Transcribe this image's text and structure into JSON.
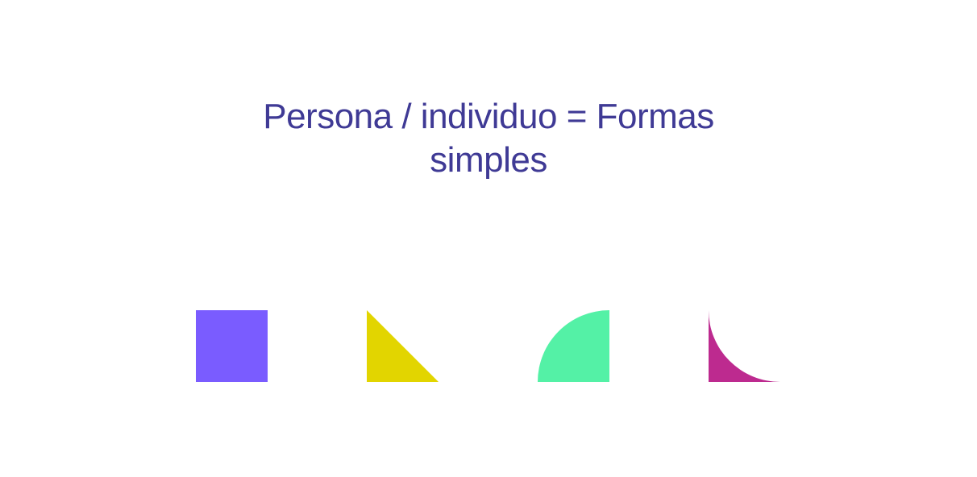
{
  "headline": {
    "line1": "Persona / individuo  =  Formas",
    "line2": "simples"
  },
  "shapes": [
    {
      "name": "square",
      "color": "#7a5cff"
    },
    {
      "name": "triangle",
      "color": "#e2d500"
    },
    {
      "name": "quarter-circle",
      "color": "#54f1a6"
    },
    {
      "name": "concave-quarter",
      "color": "#bd2a8f"
    }
  ]
}
